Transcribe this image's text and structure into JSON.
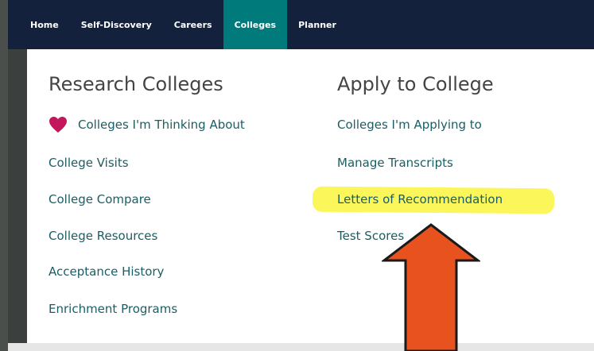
{
  "nav": {
    "items": [
      "Home",
      "Self-Discovery",
      "Careers",
      "Colleges",
      "Planner"
    ],
    "active": "Colleges"
  },
  "menu": {
    "research": {
      "heading": "Research Colleges",
      "links": [
        "Colleges I'm Thinking About",
        "College Visits",
        "College Compare",
        "College Resources",
        "Acceptance History",
        "Enrichment Programs"
      ]
    },
    "apply": {
      "heading": "Apply to College",
      "links": [
        "Colleges I'm Applying to",
        "Manage Transcripts",
        "Letters of Recommendation",
        "Test Scores"
      ]
    }
  },
  "annotation": {
    "highlight_color": "#fbf65a",
    "arrow_color": "#e8521f"
  },
  "icons": {
    "favorite": "heart-icon"
  },
  "colors": {
    "nav_bg": "#14213d",
    "active_tab": "#007a7a",
    "link": "#1a5e63"
  }
}
